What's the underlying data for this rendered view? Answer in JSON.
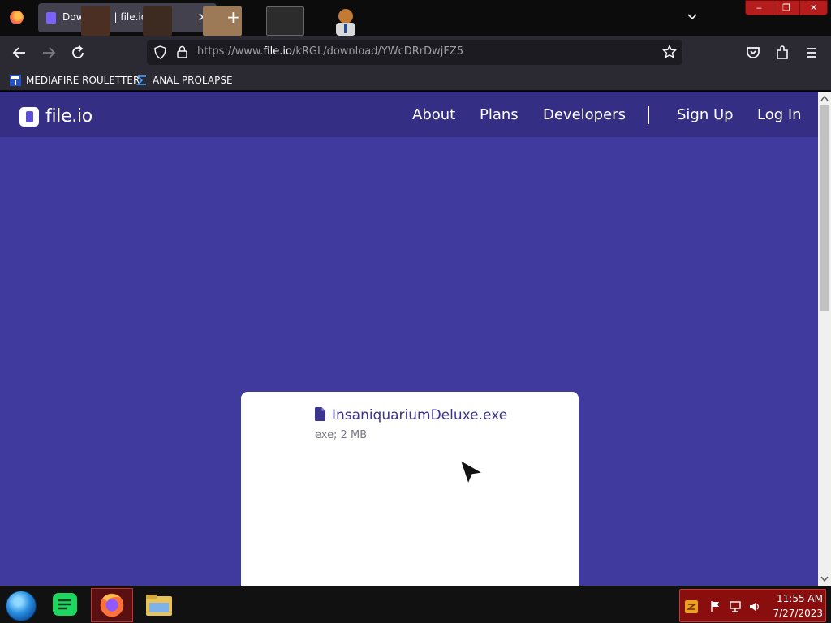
{
  "browser": {
    "tab": {
      "title": "Download | file.io",
      "close": "×"
    },
    "new_tab": "+",
    "window_controls": {
      "minimize": "‒",
      "restore": "❐",
      "close": "✕"
    },
    "url": {
      "prefix": "https://www.",
      "host": "file.io",
      "path": "/kRGL/download/YWcDRrDwjFZ5"
    },
    "bookmarks": [
      {
        "label": "MEDIAFIRE ROULETTER",
        "icon": "mft-icon"
      },
      {
        "label": "ANAL PROLAPSE",
        "icon": "sigma-icon"
      }
    ]
  },
  "site": {
    "logo": "file.io",
    "nav": {
      "about": "About",
      "plans": "Plans",
      "developers": "Developers",
      "signup": "Sign Up",
      "login": "Log In"
    },
    "file": {
      "name": "InsaniquariumDeluxe.exe",
      "meta": "exe; 2 MB"
    }
  },
  "taskbar": {
    "apps": [
      "start-orb",
      "notes-app",
      "firefox-app",
      "file-explorer-app"
    ],
    "clock": {
      "time": "11:55 AM",
      "date": "7/27/2023"
    }
  },
  "colors": {
    "page_bg": "#403a9e",
    "header_bg": "#342e85",
    "file_link": "#3b3590",
    "tray_bg": "#8a0e0e"
  }
}
